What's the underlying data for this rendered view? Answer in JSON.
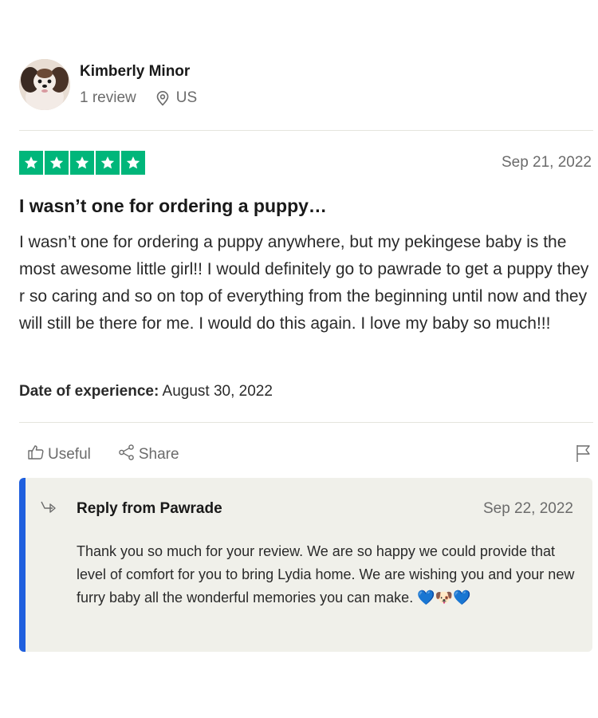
{
  "reviewer": {
    "name": "Kimberly Minor",
    "review_count": "1 review",
    "location": "US"
  },
  "review": {
    "rating": 5,
    "rating_max": 5,
    "date": "Sep 21, 2022",
    "title": "I wasn’t one for ordering a puppy…",
    "body": "I wasn’t one for ordering a puppy anywhere, but my pekingese baby is the most awesome little girl!! I would definitely go to pawrade to get a puppy they r so caring and so on top of everything from the beginning until now and they will still be there for me. I would do this again. I love my baby so much!!!",
    "experience_label": "Date of experience:",
    "experience_date": "August 30, 2022"
  },
  "actions": {
    "useful_label": "Useful",
    "share_label": "Share"
  },
  "reply": {
    "title": "Reply from Pawrade",
    "date": "Sep 22, 2022",
    "text": "Thank you so much for your review. We are so happy we could provide that level of comfort for you to bring Lydia home. We are wishing you and your new furry baby all the wonderful memories you can make.",
    "emoji": "💙🐶💙"
  },
  "colors": {
    "star_green": "#00b67a",
    "reply_accent": "#1f5fde",
    "reply_bg": "#f0f0ea"
  },
  "icons": [
    "location-pin-icon",
    "star-icon",
    "thumbs-up-icon",
    "share-icon",
    "flag-icon",
    "reply-arrow-icon"
  ]
}
